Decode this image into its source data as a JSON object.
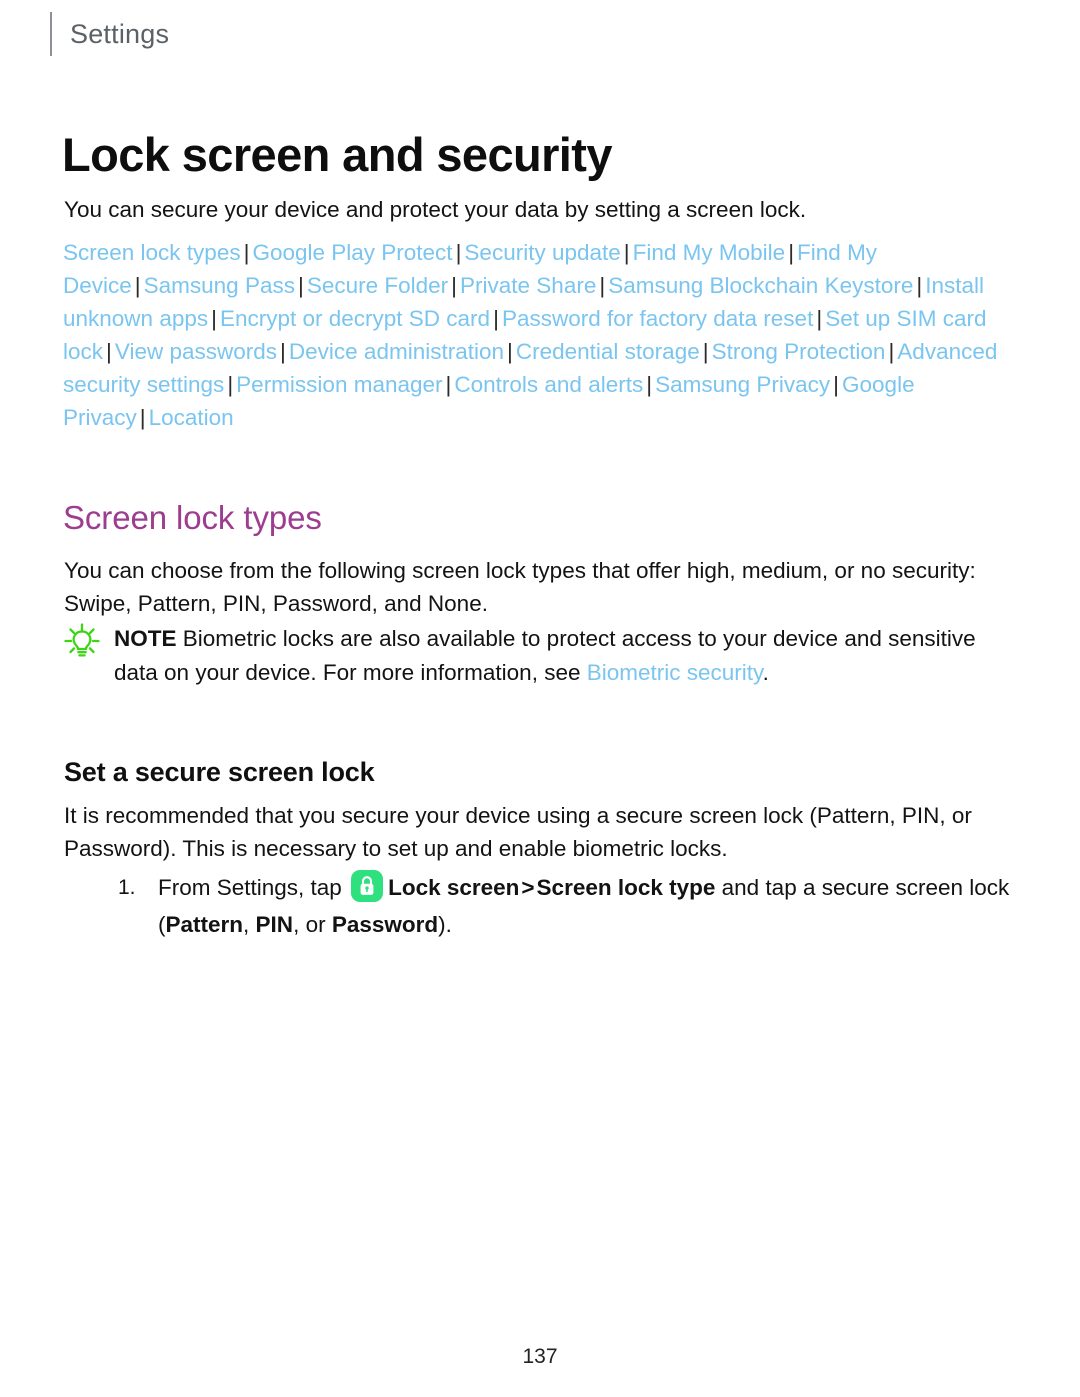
{
  "running_head": "Settings",
  "page_title": "Lock screen and security",
  "intro": "You can secure your device and protect your data by setting a screen lock.",
  "colors": {
    "link": "#7ac5f0",
    "section_heading": "#9c3d8f",
    "note_icon": "#3bd613",
    "app_icon_bg": "#2ee07e",
    "rule": "#8d9196"
  },
  "xref_links": [
    "Screen lock types",
    "Google Play Protect",
    "Security update",
    "Find My Mobile",
    "Find My Device",
    "Samsung Pass",
    "Secure Folder",
    "Private Share",
    "Samsung Blockchain Keystore",
    "Install unknown apps",
    "Encrypt or decrypt SD card",
    "Password for factory data reset",
    "Set up SIM card lock",
    "View passwords",
    "Device administration",
    "Credential storage",
    "Strong Protection",
    "Advanced security settings",
    "Permission manager",
    "Controls and alerts",
    "Samsung Privacy",
    "Google Privacy",
    "Location"
  ],
  "xref_separator": "|",
  "section": {
    "heading": "Screen lock types",
    "paragraph": "You can choose from the following screen lock types that offer high, medium, or no security: Swipe, Pattern, PIN, Password, and None."
  },
  "note": {
    "icon": "lightbulb-icon",
    "label": "NOTE",
    "text_before_link": " Biometric locks are also available to protect access to your device and sensitive data on your device. For more information, see ",
    "link": "Biometric security",
    "text_after_link": "."
  },
  "subsection": {
    "heading": "Set a secure screen lock",
    "paragraph": "It is recommended that you secure your device using a secure screen lock (Pattern, PIN, or Password). This is necessary to set up and enable biometric locks."
  },
  "steps": [
    {
      "number": "1.",
      "part1": "From Settings, tap ",
      "icon": "lock-icon",
      "bold1": "Lock screen",
      "chevron": ">",
      "bold2": "Screen lock type",
      "part2": " and tap a secure screen lock (",
      "bold3": "Pattern",
      "part3": ", ",
      "bold4": "PIN",
      "part4": ", or ",
      "bold5": "Password",
      "part5": ")."
    }
  ],
  "folio": "137"
}
